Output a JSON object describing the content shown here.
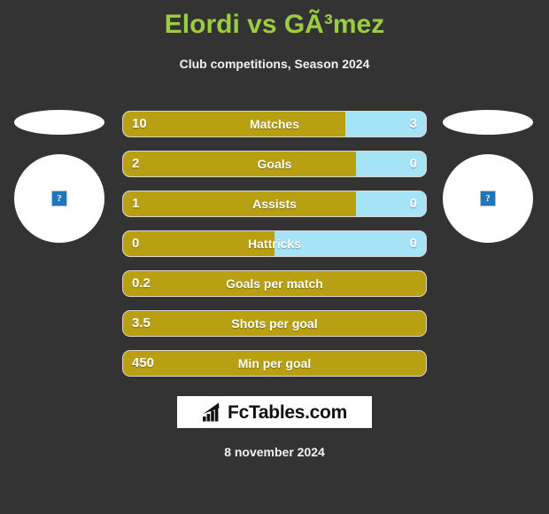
{
  "header": {
    "title": "Elordi vs GÃ³mez",
    "subtitle": "Club competitions, Season 2024"
  },
  "players": {
    "left": {
      "photo_alt": "broken-image",
      "placeholder_glyph": "?"
    },
    "right": {
      "photo_alt": "broken-image",
      "placeholder_glyph": "?"
    }
  },
  "colors": {
    "background": "#333333",
    "title": "#9acd41",
    "home_bar": "#b8a012",
    "away_bar": "#a5e4f7",
    "text": "#ffffff"
  },
  "chart_data": {
    "type": "bar",
    "title": "Elordi vs GÃ³mez",
    "subtitle": "Club competitions, Season 2024",
    "orientation": "horizontal-diverging",
    "series": [
      {
        "name": "Elordi",
        "color": "#b8a012"
      },
      {
        "name": "GÃ³mez",
        "color": "#a5e4f7"
      }
    ],
    "categories": [
      "Matches",
      "Goals",
      "Assists",
      "Hattricks",
      "Goals per match",
      "Shots per goal",
      "Min per goal"
    ],
    "rows": [
      {
        "label": "Matches",
        "home": "10",
        "away": "3",
        "home_pct": 73.5,
        "has_away": true
      },
      {
        "label": "Goals",
        "home": "2",
        "away": "0",
        "home_pct": 77.0,
        "has_away": true
      },
      {
        "label": "Assists",
        "home": "1",
        "away": "0",
        "home_pct": 77.0,
        "has_away": true
      },
      {
        "label": "Hattricks",
        "home": "0",
        "away": "0",
        "home_pct": 50.0,
        "has_away": true
      },
      {
        "label": "Goals per match",
        "home": "0.2",
        "away": "",
        "home_pct": 100,
        "has_away": false
      },
      {
        "label": "Shots per goal",
        "home": "3.5",
        "away": "",
        "home_pct": 100,
        "has_away": false
      },
      {
        "label": "Min per goal",
        "home": "450",
        "away": "",
        "home_pct": 100,
        "has_away": false
      }
    ]
  },
  "logo": {
    "text": "FcTables.com",
    "icon": "bar-chart-icon"
  },
  "footer": {
    "date": "8 november 2024"
  }
}
